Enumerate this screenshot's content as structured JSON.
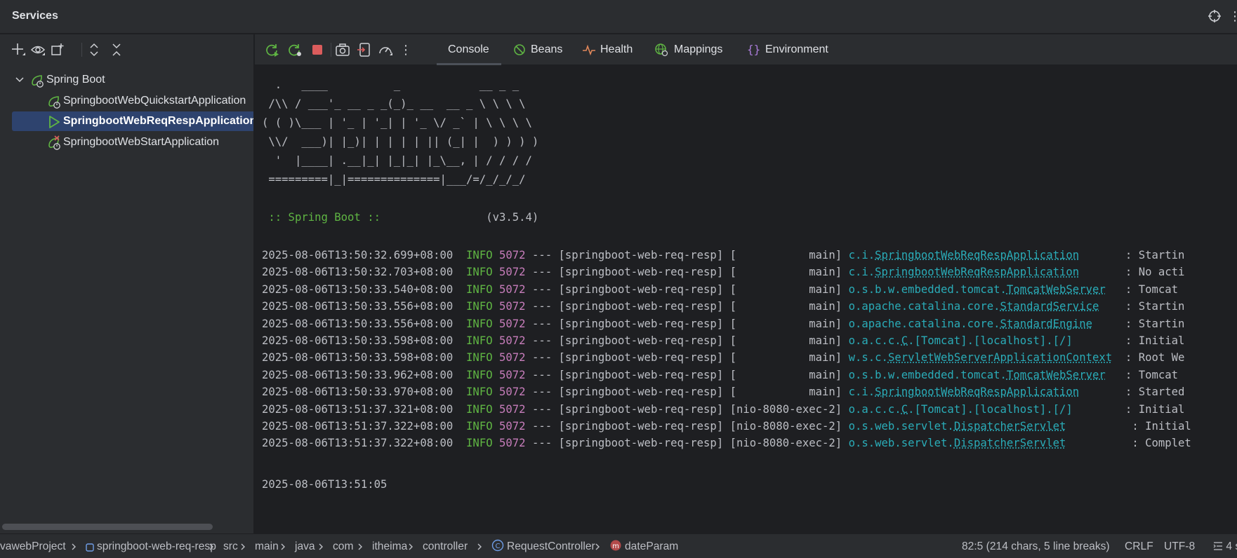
{
  "window": {
    "title": "Services"
  },
  "services_tree": {
    "root": {
      "label": "Spring Boot"
    },
    "items": [
      {
        "label": "SpringbootWebQuickstartApplication",
        "status": "idle"
      },
      {
        "label": "SpringbootWebReqRespApplication",
        "status": "running",
        "selected": true
      },
      {
        "label": "SpringbootWebStartApplication",
        "status": "error"
      }
    ]
  },
  "tabs": [
    {
      "label": "Console",
      "icon": "none",
      "active": true
    },
    {
      "label": "Beans",
      "icon": "beans-icon"
    },
    {
      "label": "Health",
      "icon": "health-icon"
    },
    {
      "label": "Mappings",
      "icon": "mappings-icon"
    },
    {
      "label": "Environment",
      "icon": "environment-icon"
    }
  ],
  "console": {
    "banner": [
      "  .   ____          _            __ _ _",
      " /\\\\ / ___'_ __ _ _(_)_ __  __ _ \\ \\ \\ \\",
      "( ( )\\___ | '_ | '_| | '_ \\/ _` | \\ \\ \\ \\",
      " \\\\/  ___)| |_)| | | | | || (_| |  ) ) ) )",
      "  '  |____| .__|_| |_|_| |_\\__, | / / / /",
      " =========|_|==============|___/=/_/_/_/"
    ],
    "spring_label": " :: Spring Boot ::",
    "spring_version": "(v3.5.4)",
    "logs": [
      {
        "ts": "2025-08-06T13:50:32.699+08:00",
        "level": "INFO",
        "pid": "5072",
        "app": "--- [springboot-web-req-resp] [           main]",
        "pkg": "c.i.",
        "cls": "SpringbootWebReqRespApplication",
        "pad": "      ",
        "msg": ": Startin"
      },
      {
        "ts": "2025-08-06T13:50:32.703+08:00",
        "level": "INFO",
        "pid": "5072",
        "app": "--- [springboot-web-req-resp] [           main]",
        "pkg": "c.i.",
        "cls": "SpringbootWebReqRespApplication",
        "pad": "      ",
        "msg": ": No acti"
      },
      {
        "ts": "2025-08-06T13:50:33.540+08:00",
        "level": "INFO",
        "pid": "5072",
        "app": "--- [springboot-web-req-resp] [           main]",
        "pkg": "o.s.b.w.embedded.tomcat.",
        "cls": "TomcatWebServer",
        "pad": "  ",
        "msg": ": Tomcat "
      },
      {
        "ts": "2025-08-06T13:50:33.556+08:00",
        "level": "INFO",
        "pid": "5072",
        "app": "--- [springboot-web-req-resp] [           main]",
        "pkg": "o.apache.catalina.core.",
        "cls": "StandardService",
        "pad": "   ",
        "msg": ": Startin"
      },
      {
        "ts": "2025-08-06T13:50:33.556+08:00",
        "level": "INFO",
        "pid": "5072",
        "app": "--- [springboot-web-req-resp] [           main]",
        "pkg": "o.apache.catalina.core.",
        "cls": "StandardEngine",
        "pad": "    ",
        "msg": ": Startin"
      },
      {
        "ts": "2025-08-06T13:50:33.598+08:00",
        "level": "INFO",
        "pid": "5072",
        "app": "--- [springboot-web-req-resp] [           main]",
        "pkg": "o.a.c.c.",
        "cls": "C",
        "pad": "",
        "msg2": ".[Tomcat].[localhost].[/]       ",
        "msg": ": Initial"
      },
      {
        "ts": "2025-08-06T13:50:33.598+08:00",
        "level": "INFO",
        "pid": "5072",
        "app": "--- [springboot-web-req-resp] [           main]",
        "pkg": "w.s.c.",
        "cls": "ServletWebServerApplicationContext",
        "pad": " ",
        "msg": ": Root We"
      },
      {
        "ts": "2025-08-06T13:50:33.962+08:00",
        "level": "INFO",
        "pid": "5072",
        "app": "--- [springboot-web-req-resp] [           main]",
        "pkg": "o.s.b.w.embedded.tomcat.",
        "cls": "TomcatWebServer",
        "pad": "  ",
        "msg": ": Tomcat "
      },
      {
        "ts": "2025-08-06T13:50:33.970+08:00",
        "level": "INFO",
        "pid": "5072",
        "app": "--- [springboot-web-req-resp] [           main]",
        "pkg": "c.i.",
        "cls": "SpringbootWebReqRespApplication",
        "pad": "      ",
        "msg": ": Started"
      },
      {
        "ts": "2025-08-06T13:51:37.321+08:00",
        "level": "INFO",
        "pid": "5072",
        "app": "--- [springboot-web-req-resp] [nio-8080-exec-2]",
        "pkg": "o.a.c.c.",
        "cls": "C",
        "pad": "",
        "msg2": ".[Tomcat].[localhost].[/]       ",
        "msg": ": Initial"
      },
      {
        "ts": "2025-08-06T13:51:37.322+08:00",
        "level": "INFO",
        "pid": "5072",
        "app": "--- [springboot-web-req-resp] [nio-8080-exec-2]",
        "pkg": "o.s.web.servlet.",
        "cls": "DispatcherServlet",
        "pad": "         ",
        "msg": ": Initial"
      },
      {
        "ts": "2025-08-06T13:51:37.322+08:00",
        "level": "INFO",
        "pid": "5072",
        "app": "--- [springboot-web-req-resp] [nio-8080-exec-2]",
        "pkg": "o.s.web.servlet.",
        "cls": "DispatcherServlet",
        "pad": "         ",
        "msg": ": Complet"
      }
    ],
    "last_line": "2025-08-06T13:51:05"
  },
  "statusbar": {
    "breadcrumbs": [
      {
        "label": "vawebProject",
        "icon": "none"
      },
      {
        "label": "springboot-web-req-resp",
        "icon": "module-icon"
      },
      {
        "label": "src",
        "icon": "none"
      },
      {
        "label": "main",
        "icon": "none"
      },
      {
        "label": "java",
        "icon": "none"
      },
      {
        "label": "com",
        "icon": "none"
      },
      {
        "label": "itheima",
        "icon": "none"
      },
      {
        "label": "controller",
        "icon": "none"
      },
      {
        "label": "RequestController",
        "icon": "class-icon"
      },
      {
        "label": "dateParam",
        "icon": "method-icon"
      }
    ],
    "position": "82:5 (214 chars, 5 line breaks)",
    "line_sep": "CRLF",
    "encoding": "UTF-8",
    "indent": "4 s"
  },
  "colors": {
    "accent_selected": "#2e436e",
    "log_level": "#5fb543",
    "pid": "#c77dbb",
    "logger": "#2aacb8",
    "stop_red": "#db5c5c"
  }
}
